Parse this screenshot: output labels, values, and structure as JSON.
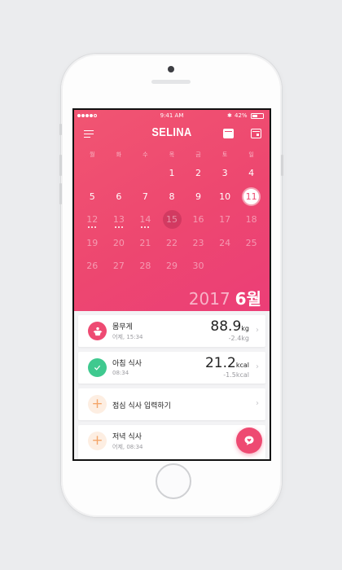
{
  "status": {
    "time": "9:41 AM",
    "battery": "42%",
    "bluetooth_icon": "bluetooth-icon"
  },
  "header": {
    "logo": "SELINA",
    "left_icon": "menu-icon",
    "right_icons": [
      "calendar-filled-icon",
      "calendar-outline-icon"
    ]
  },
  "calendar": {
    "weekdays": [
      "월",
      "화",
      "수",
      "목",
      "금",
      "토",
      "일"
    ],
    "weeks": [
      [
        "",
        "",
        "",
        "1",
        "2",
        "3",
        "4"
      ],
      [
        "5",
        "6",
        "7",
        "8",
        "9",
        "10",
        "11"
      ],
      [
        "12",
        "13",
        "14",
        "15",
        "16",
        "17",
        "18"
      ],
      [
        "19",
        "20",
        "21",
        "22",
        "23",
        "24",
        "25"
      ],
      [
        "26",
        "27",
        "28",
        "29",
        "30",
        "",
        ""
      ]
    ],
    "today": "11",
    "selected": "15",
    "dotted_days": [
      "12",
      "13",
      "14"
    ],
    "year": "2017",
    "month": "6월"
  },
  "entries": [
    {
      "title": "몸무게",
      "sub": "어제, 15:34",
      "value": "88.9",
      "unit": "kg",
      "delta": "-2.4kg",
      "icon": "weight-icon"
    },
    {
      "title": "아침 식사",
      "sub": "08:34",
      "value": "21.2",
      "unit": "kcal",
      "delta": "-1.5kcal",
      "icon": "check-icon"
    },
    {
      "title": "점심 식사 입력하기",
      "icon": "plus-icon"
    },
    {
      "title": "저녁 식사",
      "sub": "어제, 08:34",
      "icon": "plus-icon"
    }
  ],
  "colors": {
    "accent": "#ee4a72",
    "green": "#3fc98f",
    "peach": "#f4a66a"
  }
}
